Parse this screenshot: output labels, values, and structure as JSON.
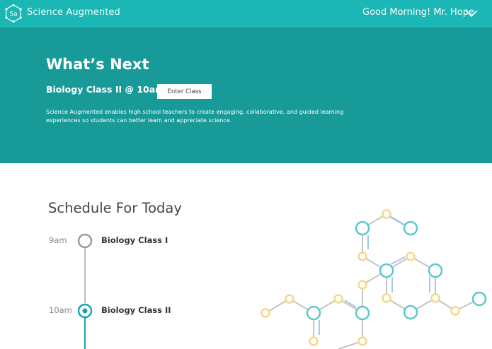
{
  "header": {
    "logo_text": "Sa",
    "app_name": "Science Augmented",
    "greeting": "Good Morning! Mr. Hope"
  },
  "hero": {
    "title": "What’s Next",
    "next_class": "Biology Class II @ 10am",
    "enter_label": "Enter Class",
    "description": "Science Augmented enables high school teachers to create engaging, collaborative, and guided learning experiences so students can better learn and appreciate science."
  },
  "schedule": {
    "title": "Schedule For Today",
    "items": [
      {
        "time": "9am",
        "name": "Biology Class I",
        "status": "past"
      },
      {
        "time": "10am",
        "name": "Biology Class II",
        "status": "current"
      }
    ]
  },
  "colors": {
    "topbar": "#1ab7b5",
    "hero": "#179a98",
    "accent": "#1aa3b5",
    "node_teal": "#5ec7cc",
    "node_yellow": "#f2d98a"
  }
}
